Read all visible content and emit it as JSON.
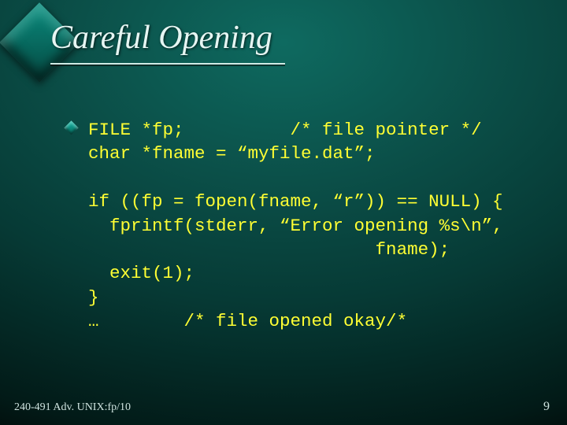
{
  "title": "Careful Opening",
  "code": "FILE *fp;          /* file pointer */\nchar *fname = “myfile.dat”;\n\nif ((fp = fopen(fname, “r”)) == NULL) {\n  fprintf(stderr, “Error opening %s\\n”,\n                           fname);\n  exit(1);\n}\n…        /* file opened okay/*",
  "footer_left": "240-491 Adv. UNIX:fp/10",
  "page_number": "9"
}
